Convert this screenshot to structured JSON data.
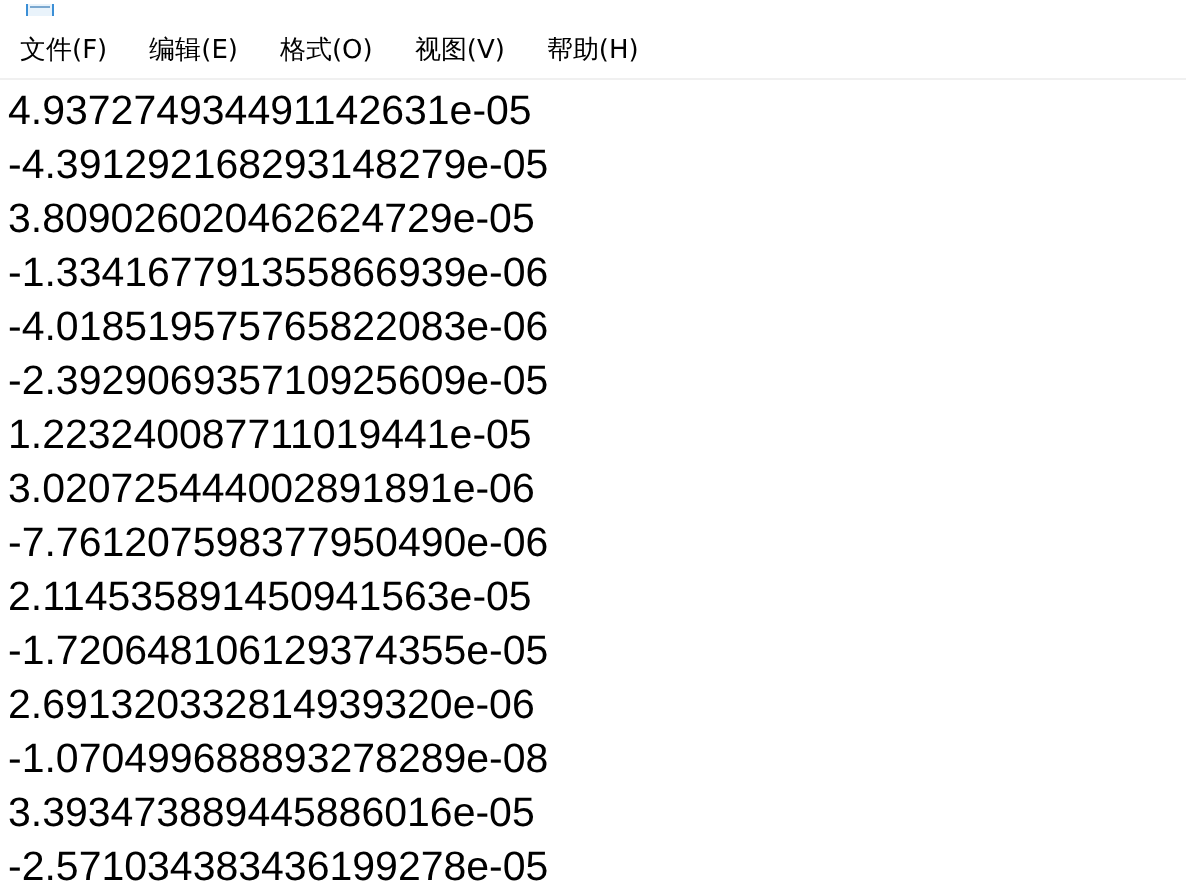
{
  "menu": [
    {
      "label": "文件(F)"
    },
    {
      "label": "编辑(E)"
    },
    {
      "label": "格式(O)"
    },
    {
      "label": "视图(V)"
    },
    {
      "label": "帮助(H)"
    }
  ],
  "lines": [
    "4.937274934491142631e-05",
    "-4.391292168293148279e-05",
    "3.809026020462624729e-05",
    "-1.334167791355866939e-06",
    "-4.018519575765822083e-06",
    "-2.392906935710925609e-05",
    "1.223240087711019441e-05",
    "3.020725444002891891e-06",
    "-7.761207598377950490e-06",
    "2.114535891450941563e-05",
    "-1.720648106129374355e-05",
    "2.691320332814939320e-06",
    "-1.070499688893278289e-08",
    "3.393473889445886016e-05",
    "-2.571034383436199278e-05"
  ]
}
